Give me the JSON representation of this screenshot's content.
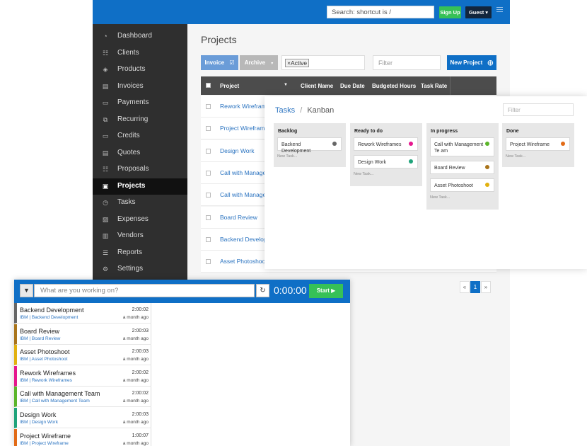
{
  "topbar": {
    "search_placeholder": "Search: shortcut is /",
    "signup_label": "Sign Up",
    "guest_label": "Guest ▾"
  },
  "sidebar": {
    "items": [
      {
        "label": "Dashboard",
        "icon": "dashboard-icon",
        "glyph": "◔"
      },
      {
        "label": "Clients",
        "icon": "users-icon",
        "glyph": "☷"
      },
      {
        "label": "Products",
        "icon": "cube-icon",
        "glyph": "◈"
      },
      {
        "label": "Invoices",
        "icon": "file-icon",
        "glyph": "▤"
      },
      {
        "label": "Payments",
        "icon": "credit-card-icon",
        "glyph": "▭"
      },
      {
        "label": "Recurring",
        "icon": "clone-icon",
        "glyph": "⧉"
      },
      {
        "label": "Credits",
        "icon": "credit-card-icon",
        "glyph": "▭"
      },
      {
        "label": "Quotes",
        "icon": "file-text-icon",
        "glyph": "▤"
      },
      {
        "label": "Proposals",
        "icon": "th-large-icon",
        "glyph": "☷"
      },
      {
        "label": "Projects",
        "icon": "briefcase-icon",
        "glyph": "▣"
      },
      {
        "label": "Tasks",
        "icon": "clock-icon",
        "glyph": "◷"
      },
      {
        "label": "Expenses",
        "icon": "file-image-icon",
        "glyph": "▨"
      },
      {
        "label": "Vendors",
        "icon": "building-icon",
        "glyph": "▥"
      },
      {
        "label": "Reports",
        "icon": "list-icon",
        "glyph": "☰"
      },
      {
        "label": "Settings",
        "icon": "gear-icon",
        "glyph": "⚙"
      }
    ],
    "active": "Projects"
  },
  "projects": {
    "title": "Projects",
    "invoice_label": "Invoice",
    "archive_label": "Archive",
    "active_chip": "×Active",
    "filter_placeholder": "Filter",
    "new_project_label": "New Project",
    "columns": [
      "Project",
      "Client Name",
      "Due Date",
      "Budgeted Hours",
      "Task Rate"
    ],
    "rows": [
      "Rework Wireframe",
      "Project Wireframe",
      "Design Work",
      "Call with Manager",
      "Call with Manager",
      "Board Review",
      "Backend Developr",
      "Asset Photoshoot"
    ]
  },
  "pagination": {
    "prev": "«",
    "current": "1",
    "next": "»"
  },
  "kanban": {
    "crumb_link": "Tasks",
    "crumb_sep": "/",
    "crumb_current": "Kanban",
    "filter_placeholder": "Filter",
    "new_task_label": "New Task...",
    "columns": [
      {
        "title": "Backlog",
        "cards": [
          {
            "text": "Backend Development",
            "color": "#666666"
          }
        ]
      },
      {
        "title": "Ready to do",
        "cards": [
          {
            "text": "Rework Wireframes",
            "color": "#e6178e"
          },
          {
            "text": "Design Work",
            "color": "#1fa37a"
          }
        ]
      },
      {
        "title": "In progress",
        "cards": [
          {
            "text": "Call with Management Te am",
            "color": "#5bb52a"
          },
          {
            "text": "Board Review",
            "color": "#a9741a"
          },
          {
            "text": "Asset Photoshoot",
            "color": "#e2b10f"
          }
        ]
      },
      {
        "title": "Done",
        "cards": [
          {
            "text": "Project Wireframe",
            "color": "#e26b17"
          }
        ]
      }
    ]
  },
  "tracker": {
    "placeholder": "What are you working on?",
    "time": "0:00:00",
    "start_label": "Start ▶",
    "entries": [
      {
        "title": "Backend Development",
        "client": "IBM | Backend Development",
        "duration": "2:00:02",
        "ago": "a month ago",
        "color": "#666666"
      },
      {
        "title": "Board Review",
        "client": "IBM | Board Review",
        "duration": "2:00:03",
        "ago": "a month ago",
        "color": "#a9741a"
      },
      {
        "title": "Asset Photoshoot",
        "client": "IBM | Asset Photoshoot",
        "duration": "2:00:03",
        "ago": "a month ago",
        "color": "#e2b10f"
      },
      {
        "title": "Rework Wireframes",
        "client": "IBM | Rework Wireframes",
        "duration": "2:00:02",
        "ago": "a month ago",
        "color": "#e6178e"
      },
      {
        "title": "Call with Management Team",
        "client": "IBM | Call with Management Team",
        "duration": "2:00:02",
        "ago": "a month ago",
        "color": "#5bb52a"
      },
      {
        "title": "Design Work",
        "client": "IBM | Design Work",
        "duration": "2:00:03",
        "ago": "a month ago",
        "color": "#1fa37a"
      },
      {
        "title": "Project Wireframe",
        "client": "IBM | Project Wireframe",
        "duration": "1:00:07",
        "ago": "a month ago",
        "color": "#e26b17"
      }
    ]
  },
  "colors": {
    "topbar": "#0f6fc6",
    "sidebar": "#2f2f2f",
    "success": "#36c157",
    "link": "#2a73c0"
  }
}
